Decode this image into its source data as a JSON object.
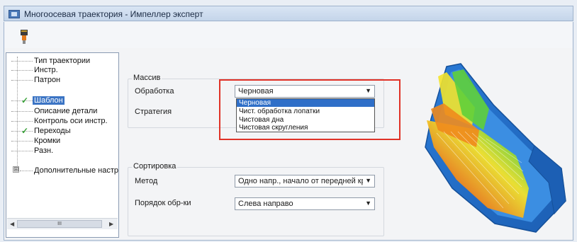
{
  "window": {
    "title": "Многоосевая траектория - Импеллер эксперт",
    "app_icon": "window-app-icon"
  },
  "toolbar": {
    "tool_icon": "cutting-tool-icon"
  },
  "tree": {
    "items": [
      {
        "label": "Тип траектории",
        "checked": false,
        "selected": false
      },
      {
        "label": "Инстр.",
        "checked": false,
        "selected": false
      },
      {
        "label": "Патрон",
        "checked": false,
        "selected": false
      },
      {
        "label": "Шаблон",
        "checked": true,
        "selected": true
      },
      {
        "label": "Описание детали",
        "checked": false,
        "selected": false
      },
      {
        "label": "Контроль оси инстр.",
        "checked": false,
        "selected": false
      },
      {
        "label": "Переходы",
        "checked": true,
        "selected": false
      },
      {
        "label": "Кромки",
        "checked": false,
        "selected": false
      },
      {
        "label": "Разн.",
        "checked": false,
        "selected": false
      },
      {
        "label": "Дополнительные настр",
        "checked": false,
        "selected": false
      }
    ],
    "expander": "⊞",
    "scroll_thumb": "III"
  },
  "array_group": {
    "title": "Массив",
    "processing_label": "Обработка",
    "processing_value": "Черновая",
    "strategy_label": "Стратегия",
    "dropdown_options": [
      "Черновая",
      "Чист. обработка лопатки",
      "Чистовая дна",
      "Чистовая скругления"
    ],
    "dropdown_selected_index": 0
  },
  "sort_group": {
    "title": "Сортировка",
    "method_label": "Метод",
    "method_value": "Одно напр., начало от передней кромк",
    "order_label": "Порядок обр-ки",
    "order_value": "Слева направо"
  },
  "colors": {
    "highlight": "#e03227",
    "selection": "#3b74c4",
    "check": "#3ba33b",
    "impeller_blue": "#2f7fd1"
  }
}
